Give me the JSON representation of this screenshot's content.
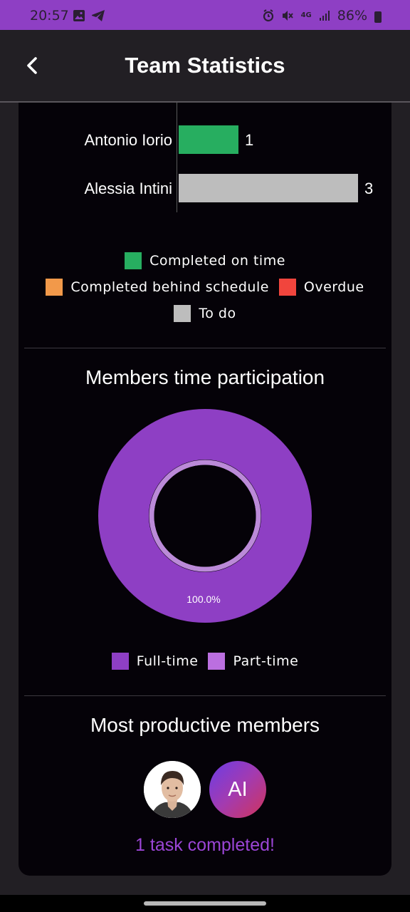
{
  "status_bar": {
    "time": "20:57",
    "battery": "86%",
    "network": "4G",
    "icons": [
      "image-icon",
      "telegram-icon",
      "alarm-icon",
      "mute-icon",
      "network-4g-icon",
      "signal-icon",
      "battery-icon"
    ]
  },
  "header": {
    "title": "Team Statistics",
    "back_icon": "chevron-left-icon"
  },
  "task_chart": {
    "legend": [
      {
        "label": "Completed on time",
        "color": "#27ae60"
      },
      {
        "label": "Completed behind schedule",
        "color": "#f2994a"
      },
      {
        "label": "Overdue",
        "color": "#f1453d"
      },
      {
        "label": "To do",
        "color": "#bdbdbd"
      }
    ]
  },
  "participation": {
    "title": "Members time participation",
    "slice_label": "100.0%",
    "legend": [
      {
        "label": "Full-time",
        "color": "#8e3fc4"
      },
      {
        "label": "Part-time",
        "color": "#bb6fe0"
      }
    ]
  },
  "productive": {
    "title": "Most productive members",
    "members": [
      {
        "type": "photo"
      },
      {
        "initials": "AI"
      }
    ],
    "caption": "1 task completed!"
  },
  "chart_data": [
    {
      "type": "bar",
      "orientation": "horizontal",
      "stacked": true,
      "categories": [
        "Antonio Iorio",
        "Alessia Intini"
      ],
      "series": [
        {
          "name": "Completed on time",
          "color": "#27ae60",
          "values": [
            1,
            0
          ]
        },
        {
          "name": "Completed behind schedule",
          "color": "#f2994a",
          "values": [
            0,
            0
          ]
        },
        {
          "name": "Overdue",
          "color": "#f1453d",
          "values": [
            0,
            0
          ]
        },
        {
          "name": "To do",
          "color": "#bdbdbd",
          "values": [
            0,
            3
          ]
        }
      ],
      "totals": [
        "1",
        "3"
      ],
      "xlim": [
        0,
        3
      ],
      "legend_position": "bottom"
    },
    {
      "type": "pie",
      "style": "donut",
      "categories": [
        "Full-time",
        "Part-time"
      ],
      "values": [
        100,
        0
      ],
      "colors": [
        "#8e3fc4",
        "#bb6fe0"
      ],
      "labels": [
        "100.0%"
      ],
      "legend_position": "bottom"
    }
  ]
}
